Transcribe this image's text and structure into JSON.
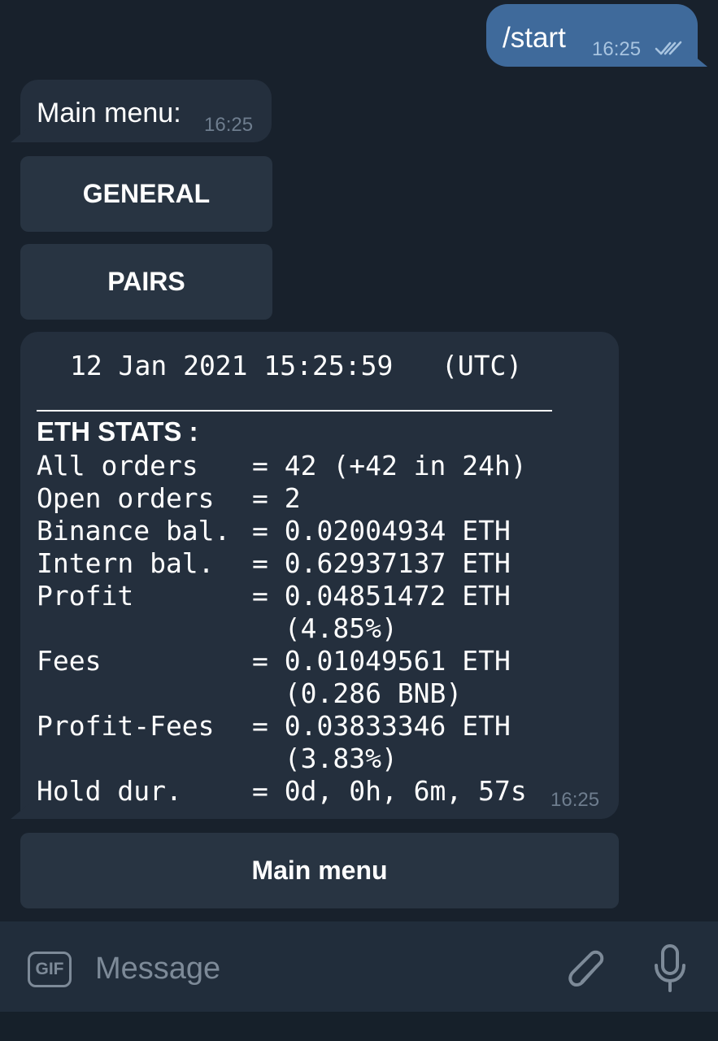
{
  "outgoing": {
    "text": "/start",
    "time": "16:25",
    "status_icon": "double-check-icon"
  },
  "menu_message": {
    "text": "Main menu:",
    "time": "16:25"
  },
  "keyboard_top": [
    "GENERAL",
    "PAIRS"
  ],
  "stats_message": {
    "date_line": "12 Jan 2021 15:25:59   (UTC)",
    "heading": "ETH STATS :",
    "rows": [
      {
        "label": "All orders",
        "value": "= 42 (+42 in 24h)"
      },
      {
        "label": "Open orders",
        "value": "= 2"
      },
      {
        "label": "Binance bal.",
        "value": "= 0.02004934 ETH"
      },
      {
        "label": "Intern bal.",
        "value": "= 0.62937137 ETH"
      },
      {
        "label": "Profit",
        "value": "= 0.04851472 ETH"
      },
      {
        "label": "",
        "value": "  (4.85%)"
      },
      {
        "label": "Fees",
        "value": "= 0.01049561 ETH"
      },
      {
        "label": "",
        "value": "  (0.286 BNB)"
      },
      {
        "label": "Profit-Fees",
        "value": "= 0.03833346 ETH"
      },
      {
        "label": "",
        "value": "  (3.83%)"
      },
      {
        "label": "Hold dur.",
        "value": "= 0d, 0h, 6m, 57s"
      }
    ],
    "time": "16:25"
  },
  "keyboard_bottom": "Main menu",
  "input_bar": {
    "gif_label": "GIF",
    "placeholder": "Message",
    "attach_icon": "paperclip-icon",
    "mic_icon": "microphone-icon"
  },
  "colors": {
    "background": "#18212c",
    "incoming_bubble": "#242f3d",
    "outgoing_bubble": "#3f6a9b",
    "keyboard_button": "#283442"
  }
}
